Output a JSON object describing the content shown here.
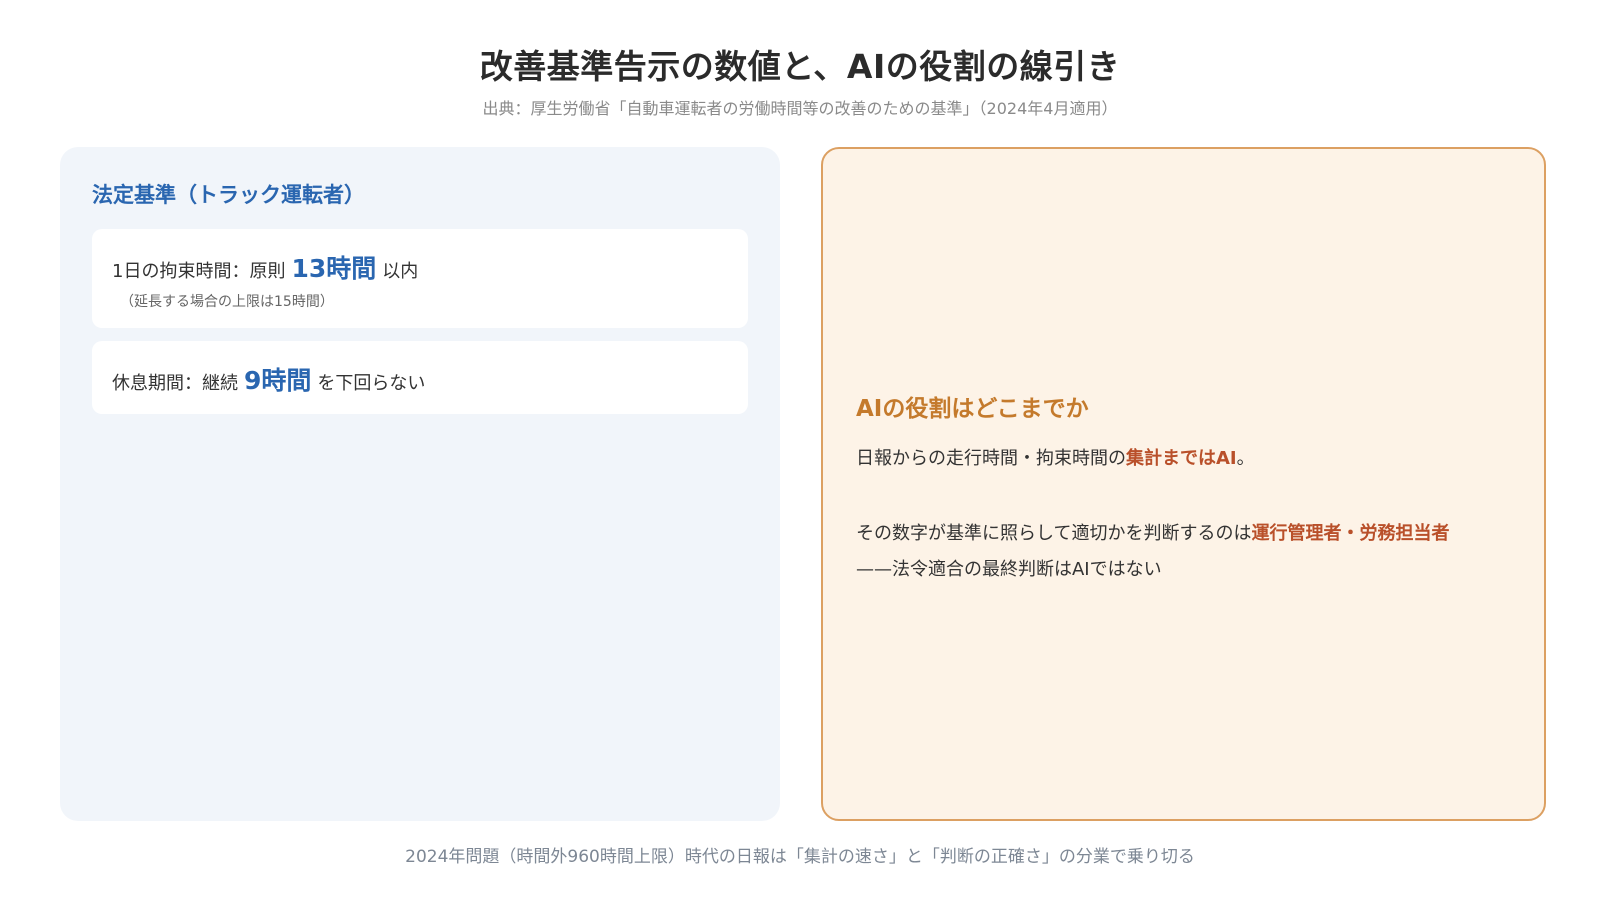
{
  "header": {
    "title": "改善基準告示の数値と、AIの役割の線引き",
    "source": "出典：厚生労働省「自動車運転者の労働時間等の改善のための基準」（2024年4月適用）"
  },
  "left_panel": {
    "heading": "法定基準（トラック運転者）",
    "card1": {
      "prefix": "1日の拘束時間：原則",
      "value": "13時間",
      "suffix": "以内",
      "note": "（延長する場合の上限は15時間）"
    },
    "card2": {
      "prefix": "休息期間：継続",
      "value": "9時間",
      "suffix": "を下回らない"
    }
  },
  "right_panel": {
    "heading": "AIの役割はどこまでか",
    "line1_text": "日報からの走行時間・拘束時間の",
    "line1_highlight": "集計まではAI",
    "line1_end": "。",
    "line2_text": "その数字が基準に照らして適切かを判断するのは",
    "line2_highlight": "運行管理者・労務担当者",
    "line3_text": "——法令適合の最終判断はAIではない"
  },
  "footer": {
    "text": "2024年問題（時間外960時間上限）時代の日報は「集計の速さ」と「判断の正確さ」の分業で乗り切る"
  }
}
